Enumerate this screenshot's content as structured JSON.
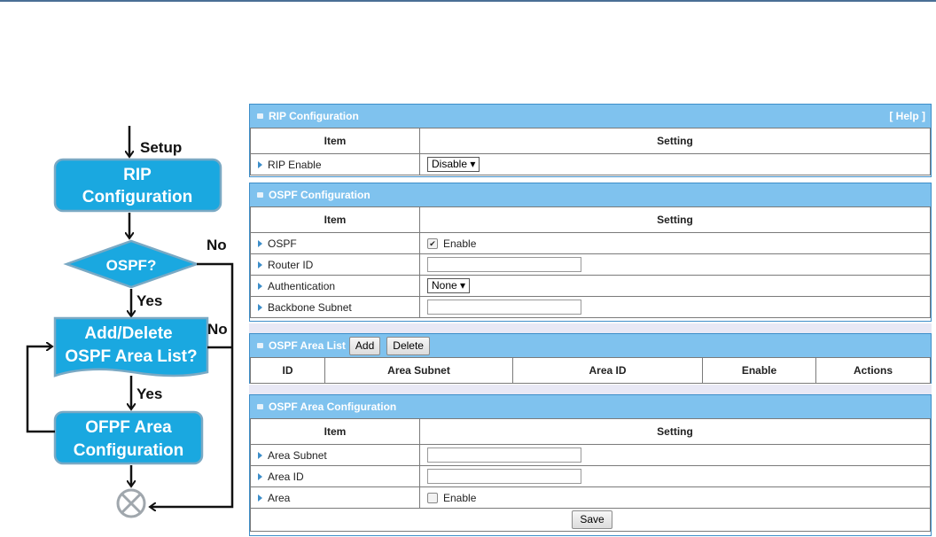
{
  "flowchart": {
    "setup_label": "Setup",
    "rip_box": [
      "RIP",
      "Configuration"
    ],
    "ospf_decision": "OSPF?",
    "yes1": "Yes",
    "no1": "No",
    "add_delete_box": [
      "Add/Delete",
      "OSPF Area List?"
    ],
    "no2": "No",
    "yes2": "Yes",
    "ofpf_box": [
      "OFPF Area",
      "Configuration"
    ],
    "box_color": "#1aa8e0",
    "decision_color": "#1aa8e0"
  },
  "rip": {
    "title": "RIP Configuration",
    "help": "[ Help ]",
    "col_item": "Item",
    "col_setting": "Setting",
    "rip_enable_label": "RIP Enable",
    "rip_enable_value": "Disable ▾"
  },
  "ospf": {
    "title": "OSPF Configuration",
    "col_item": "Item",
    "col_setting": "Setting",
    "ospf_label": "OSPF",
    "ospf_enable": "Enable",
    "router_id_label": "Router ID",
    "auth_label": "Authentication",
    "auth_value": "None ▾",
    "backbone_label": "Backbone Subnet"
  },
  "area_list": {
    "title": "OSPF Area List",
    "add": "Add",
    "delete": "Delete",
    "columns": [
      "ID",
      "Area Subnet",
      "Area ID",
      "Enable",
      "Actions"
    ]
  },
  "area_config": {
    "title": "OSPF Area Configuration",
    "col_item": "Item",
    "col_setting": "Setting",
    "area_subnet_label": "Area Subnet",
    "area_id_label": "Area ID",
    "area_label": "Area",
    "area_enable": "Enable",
    "save": "Save"
  },
  "colors": {
    "header": "#7fc2ee",
    "border": "#3d8ec9",
    "accent": "#1aa8e0"
  }
}
